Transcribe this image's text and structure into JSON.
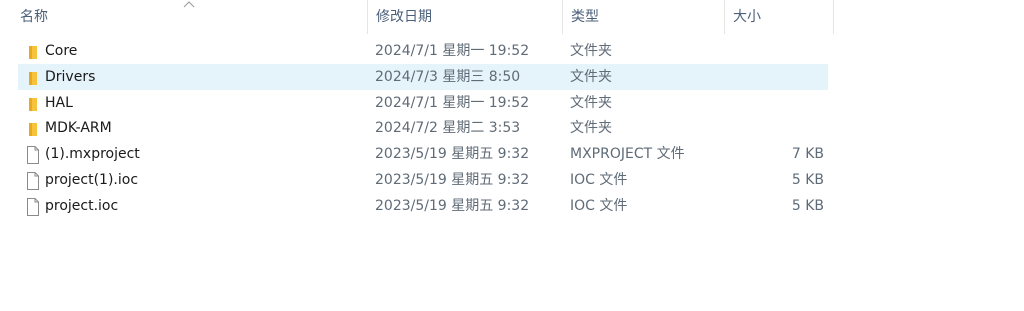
{
  "columns": {
    "name": "名称",
    "modified": "修改日期",
    "type": "类型",
    "size": "大小"
  },
  "files": [
    {
      "name": "Core",
      "modified": "2024/7/1 星期一 19:52",
      "type": "文件夹",
      "size": "",
      "icon": "folder-icon"
    },
    {
      "name": "Drivers",
      "modified": "2024/7/3 星期三 8:50",
      "type": "文件夹",
      "size": "",
      "icon": "folder-icon"
    },
    {
      "name": "HAL",
      "modified": "2024/7/1 星期一 19:52",
      "type": "文件夹",
      "size": "",
      "icon": "folder-icon"
    },
    {
      "name": "MDK-ARM",
      "modified": "2024/7/2 星期二 3:53",
      "type": "文件夹",
      "size": "",
      "icon": "folder-icon"
    },
    {
      "name": "(1).mxproject",
      "modified": "2023/5/19 星期五 9:32",
      "type": "MXPROJECT 文件",
      "size": "7 KB",
      "icon": "file-icon"
    },
    {
      "name": "project(1).ioc",
      "modified": "2023/5/19 星期五 9:32",
      "type": "IOC 文件",
      "size": "5 KB",
      "icon": "file-icon"
    },
    {
      "name": "project.ioc",
      "modified": "2023/5/19 星期五 9:32",
      "type": "IOC 文件",
      "size": "5 KB",
      "icon": "file-icon"
    }
  ],
  "selected_index": 1,
  "colors": {
    "folder": "#f7c33b",
    "selection": "#e5f3fb",
    "header_text": "#4c607a"
  }
}
